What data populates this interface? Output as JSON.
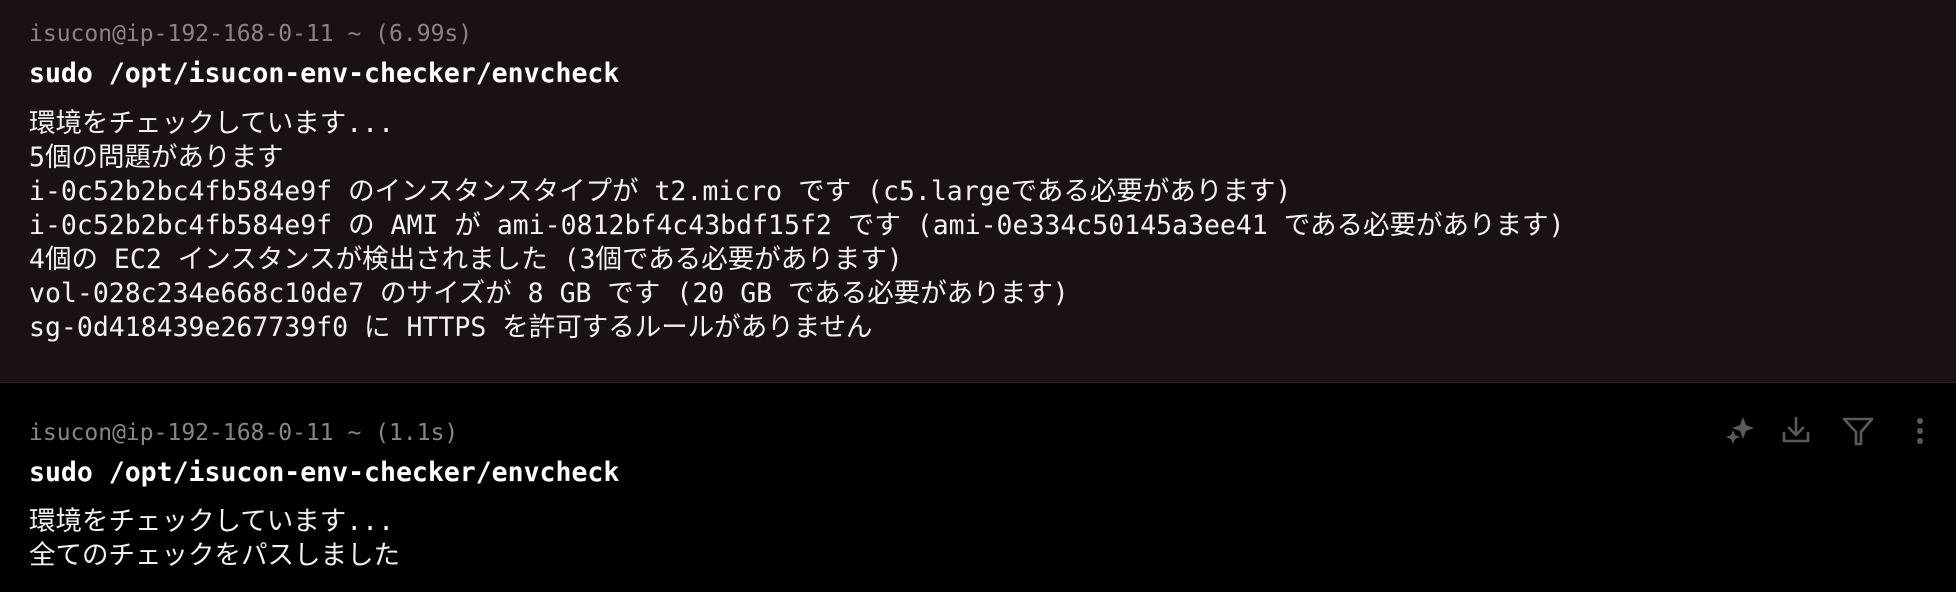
{
  "blocks": [
    {
      "prompt": "isucon@ip-192-168-0-11 ~ (6.99s)",
      "command": "sudo /opt/isucon-env-checker/envcheck",
      "output": [
        "環境をチェックしています...",
        "5個の問題があります",
        "i-0c52b2bc4fb584e9f のインスタンスタイプが t2.micro です (c5.largeである必要があります)",
        "i-0c52b2bc4fb584e9f の AMI が ami-0812bf4c43bdf15f2 です (ami-0e334c50145a3ee41 である必要があります)",
        "4個の EC2 インスタンスが検出されました (3個である必要があります)",
        "vol-028c234e668c10de7 のサイズが 8 GB です (20 GB である必要があります)",
        "sg-0d418439e267739f0 に HTTPS を許可するルールがありません"
      ]
    },
    {
      "prompt": "isucon@ip-192-168-0-11 ~ (1.1s)",
      "command": "sudo /opt/isucon-env-checker/envcheck",
      "output": [
        "環境をチェックしています...",
        "全てのチェックをパスしました"
      ],
      "toolbar_icons": [
        "sparkles-icon",
        "download-icon",
        "filter-icon",
        "more-vertical-icon"
      ]
    }
  ]
}
